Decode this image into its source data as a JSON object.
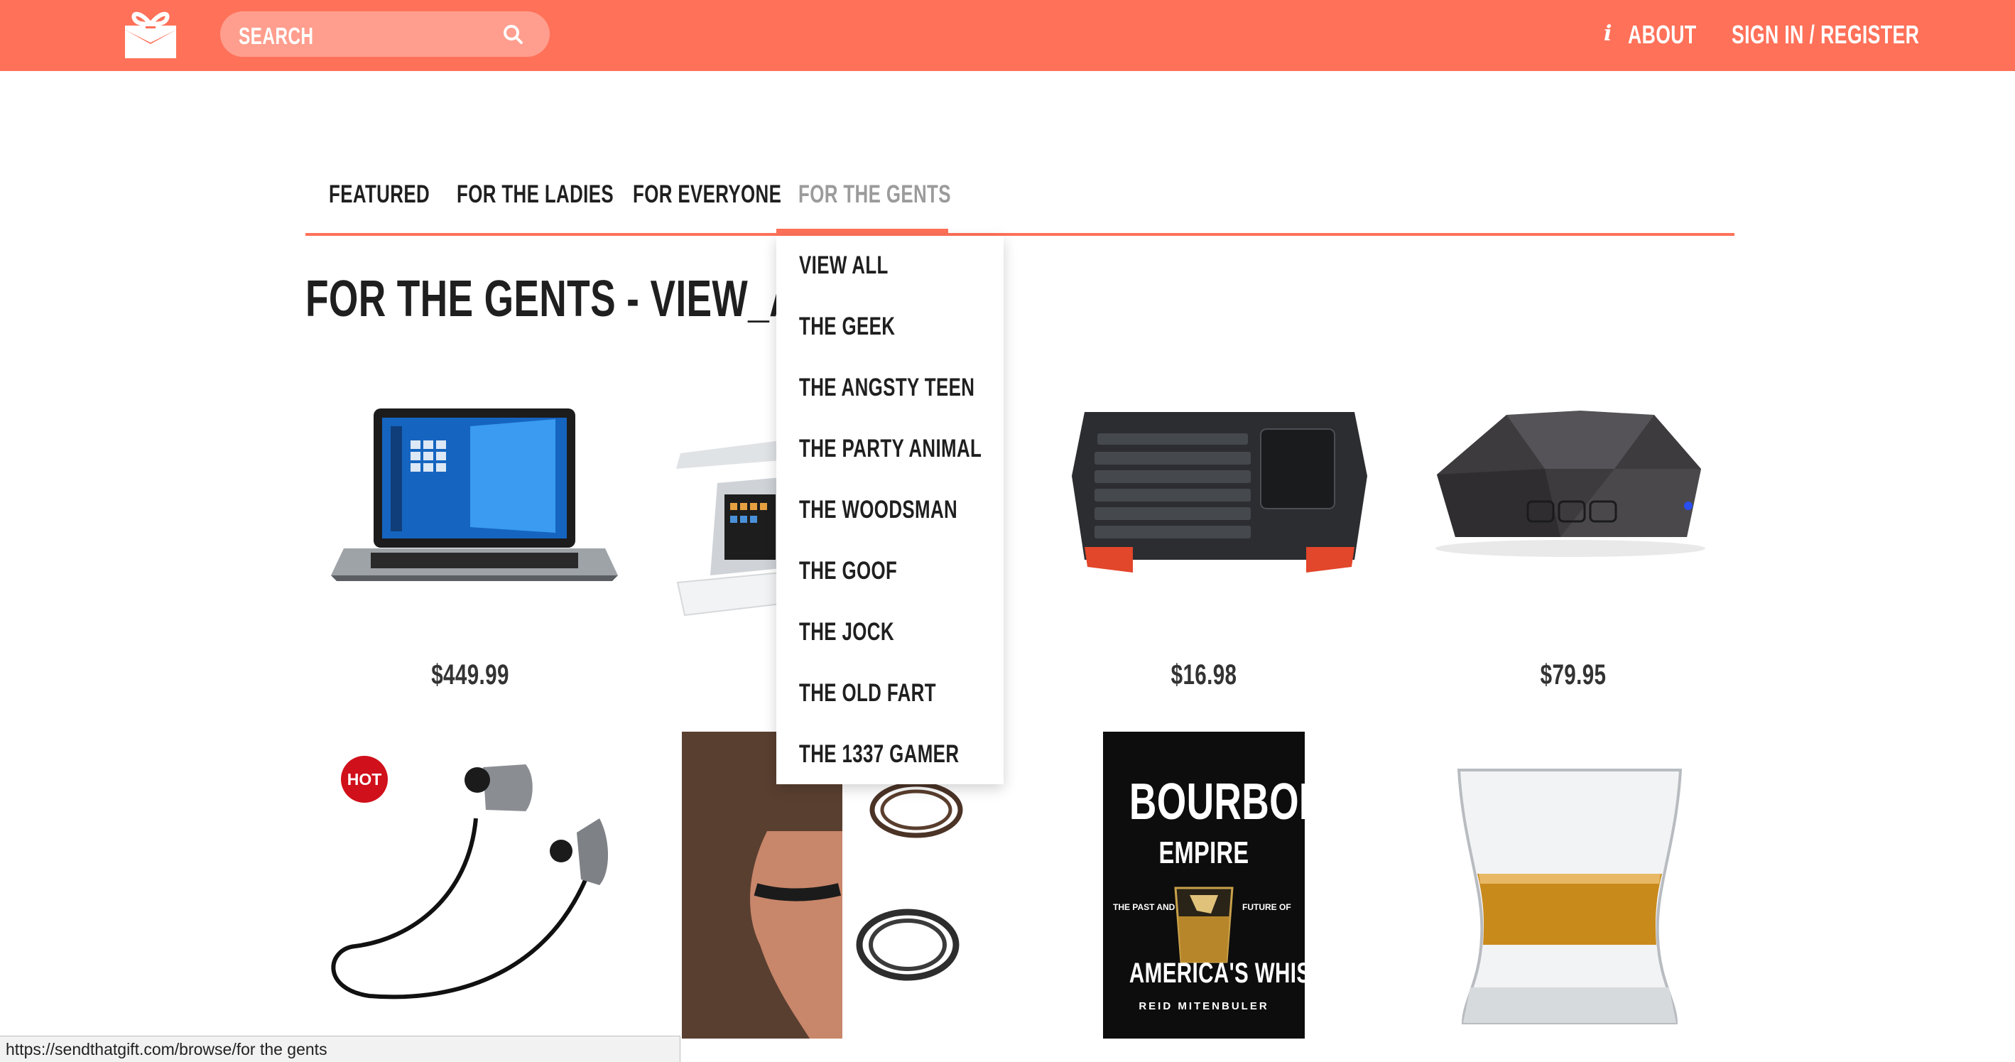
{
  "header": {
    "search_placeholder": "SEARCH",
    "about_label": "ABOUT",
    "signin_label": "SIGN IN / REGISTER"
  },
  "tabs": [
    {
      "label": "FEATURED"
    },
    {
      "label": "FOR THE LADIES"
    },
    {
      "label": "FOR EVERYONE"
    },
    {
      "label": "FOR THE GENTS"
    }
  ],
  "page_title": "FOR THE GENTS - VIEW_ALL",
  "dropdown": [
    {
      "label": "VIEW ALL"
    },
    {
      "label": "THE GEEK"
    },
    {
      "label": "THE ANGSTY TEEN"
    },
    {
      "label": "THE PARTY ANIMAL"
    },
    {
      "label": "THE WOODSMAN"
    },
    {
      "label": "THE GOOF"
    },
    {
      "label": "THE JOCK"
    },
    {
      "label": "THE OLD FART"
    },
    {
      "label": "THE 1337 GAMER"
    }
  ],
  "products": [
    {
      "price": "$449.99"
    },
    {
      "price": ""
    },
    {
      "price": "$16.98"
    },
    {
      "price": "$79.95"
    }
  ],
  "hot_badge": "HOT",
  "book": {
    "title_top": "BOURBON",
    "title_mid": "EMPIRE",
    "subtitle_left": "THE PAST AND",
    "subtitle_right": "FUTURE OF",
    "title_bottom": "AMERICA'S WHISKEY",
    "author": "REID MITENBULER"
  },
  "status_url": "https://sendthatgift.com/browse/for the gents",
  "colors": {
    "accent": "#ff7159",
    "hot": "#d0101a"
  }
}
